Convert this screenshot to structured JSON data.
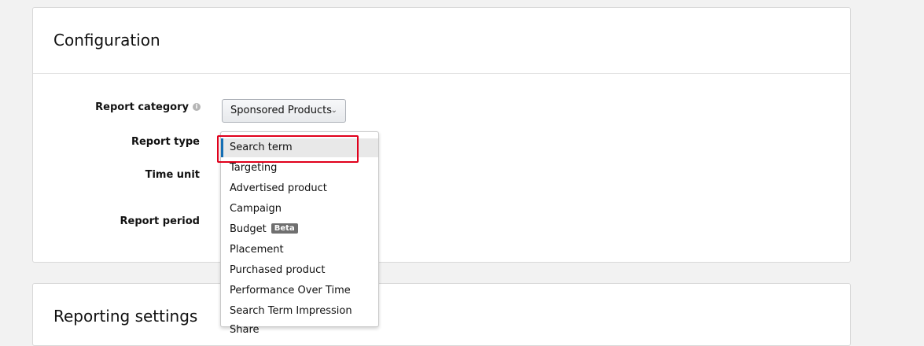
{
  "configuration": {
    "title": "Configuration",
    "report_category": {
      "label": "Report category",
      "selected_value": "Sponsored Products"
    },
    "report_type": {
      "label": "Report type"
    },
    "time_unit": {
      "label": "Time unit"
    },
    "report_period": {
      "label": "Report period"
    }
  },
  "report_type_dropdown": {
    "items": [
      {
        "label": "Search term",
        "selected": true
      },
      {
        "label": "Targeting"
      },
      {
        "label": "Advertised product"
      },
      {
        "label": "Campaign"
      },
      {
        "label": "Budget",
        "badge": "Beta"
      },
      {
        "label": "Placement"
      },
      {
        "label": "Purchased product"
      },
      {
        "label": "Performance Over Time"
      },
      {
        "label": "Search Term Impression Share"
      }
    ]
  },
  "reporting_settings": {
    "title": "Reporting settings"
  },
  "colors": {
    "highlight_border": "#e0001b",
    "selected_indicator": "#146eb4",
    "badge_bg": "#6f6f6f"
  }
}
